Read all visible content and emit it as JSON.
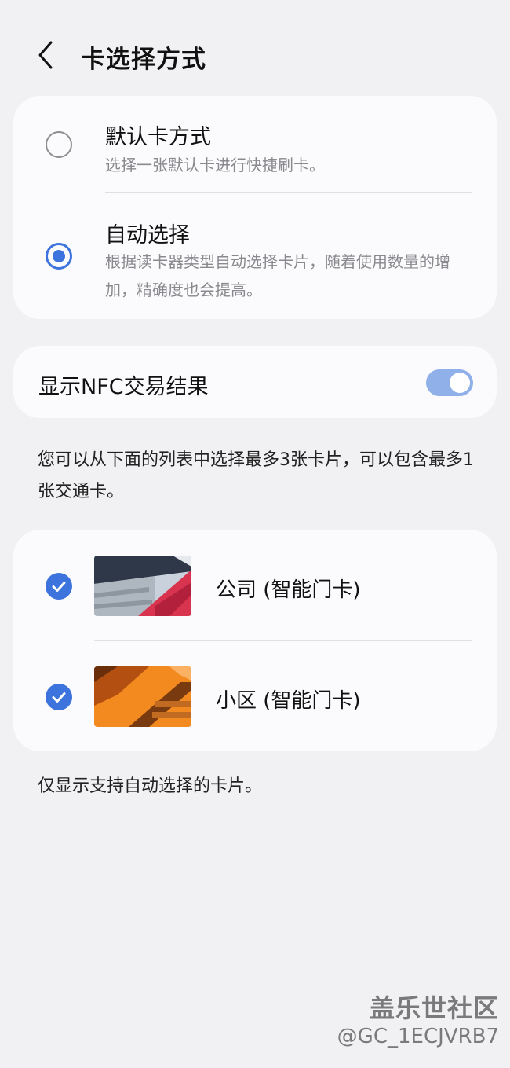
{
  "header": {
    "title": "卡选择方式",
    "back_icon": "chevron-left-icon"
  },
  "selection_mode": {
    "options": [
      {
        "title": "默认卡方式",
        "description": "选择一张默认卡进行快捷刷卡。",
        "selected": false
      },
      {
        "title": "自动选择",
        "description": "根据读卡器类型自动选择卡片，随着使用数量的增加，精确度也会提高。",
        "selected": true
      }
    ]
  },
  "nfc_result": {
    "label": "显示NFC交易结果",
    "enabled": true
  },
  "info_text": "您可以从下面的列表中选择最多3张卡片，可以包含最多1张交通卡。",
  "cards": [
    {
      "name": "公司 (智能门卡)",
      "checked": true
    },
    {
      "name": "小区 (智能门卡)",
      "checked": true
    }
  ],
  "footer_note": "仅显示支持自动选择的卡片。",
  "watermark": {
    "title": "盖乐世社区",
    "user": "@GC_1ECJVRB7"
  },
  "colors": {
    "accent": "#3d73dd",
    "toggle_track": "#8fb0e9",
    "background": "#f1f1f4",
    "card": "#fbfbfd"
  }
}
